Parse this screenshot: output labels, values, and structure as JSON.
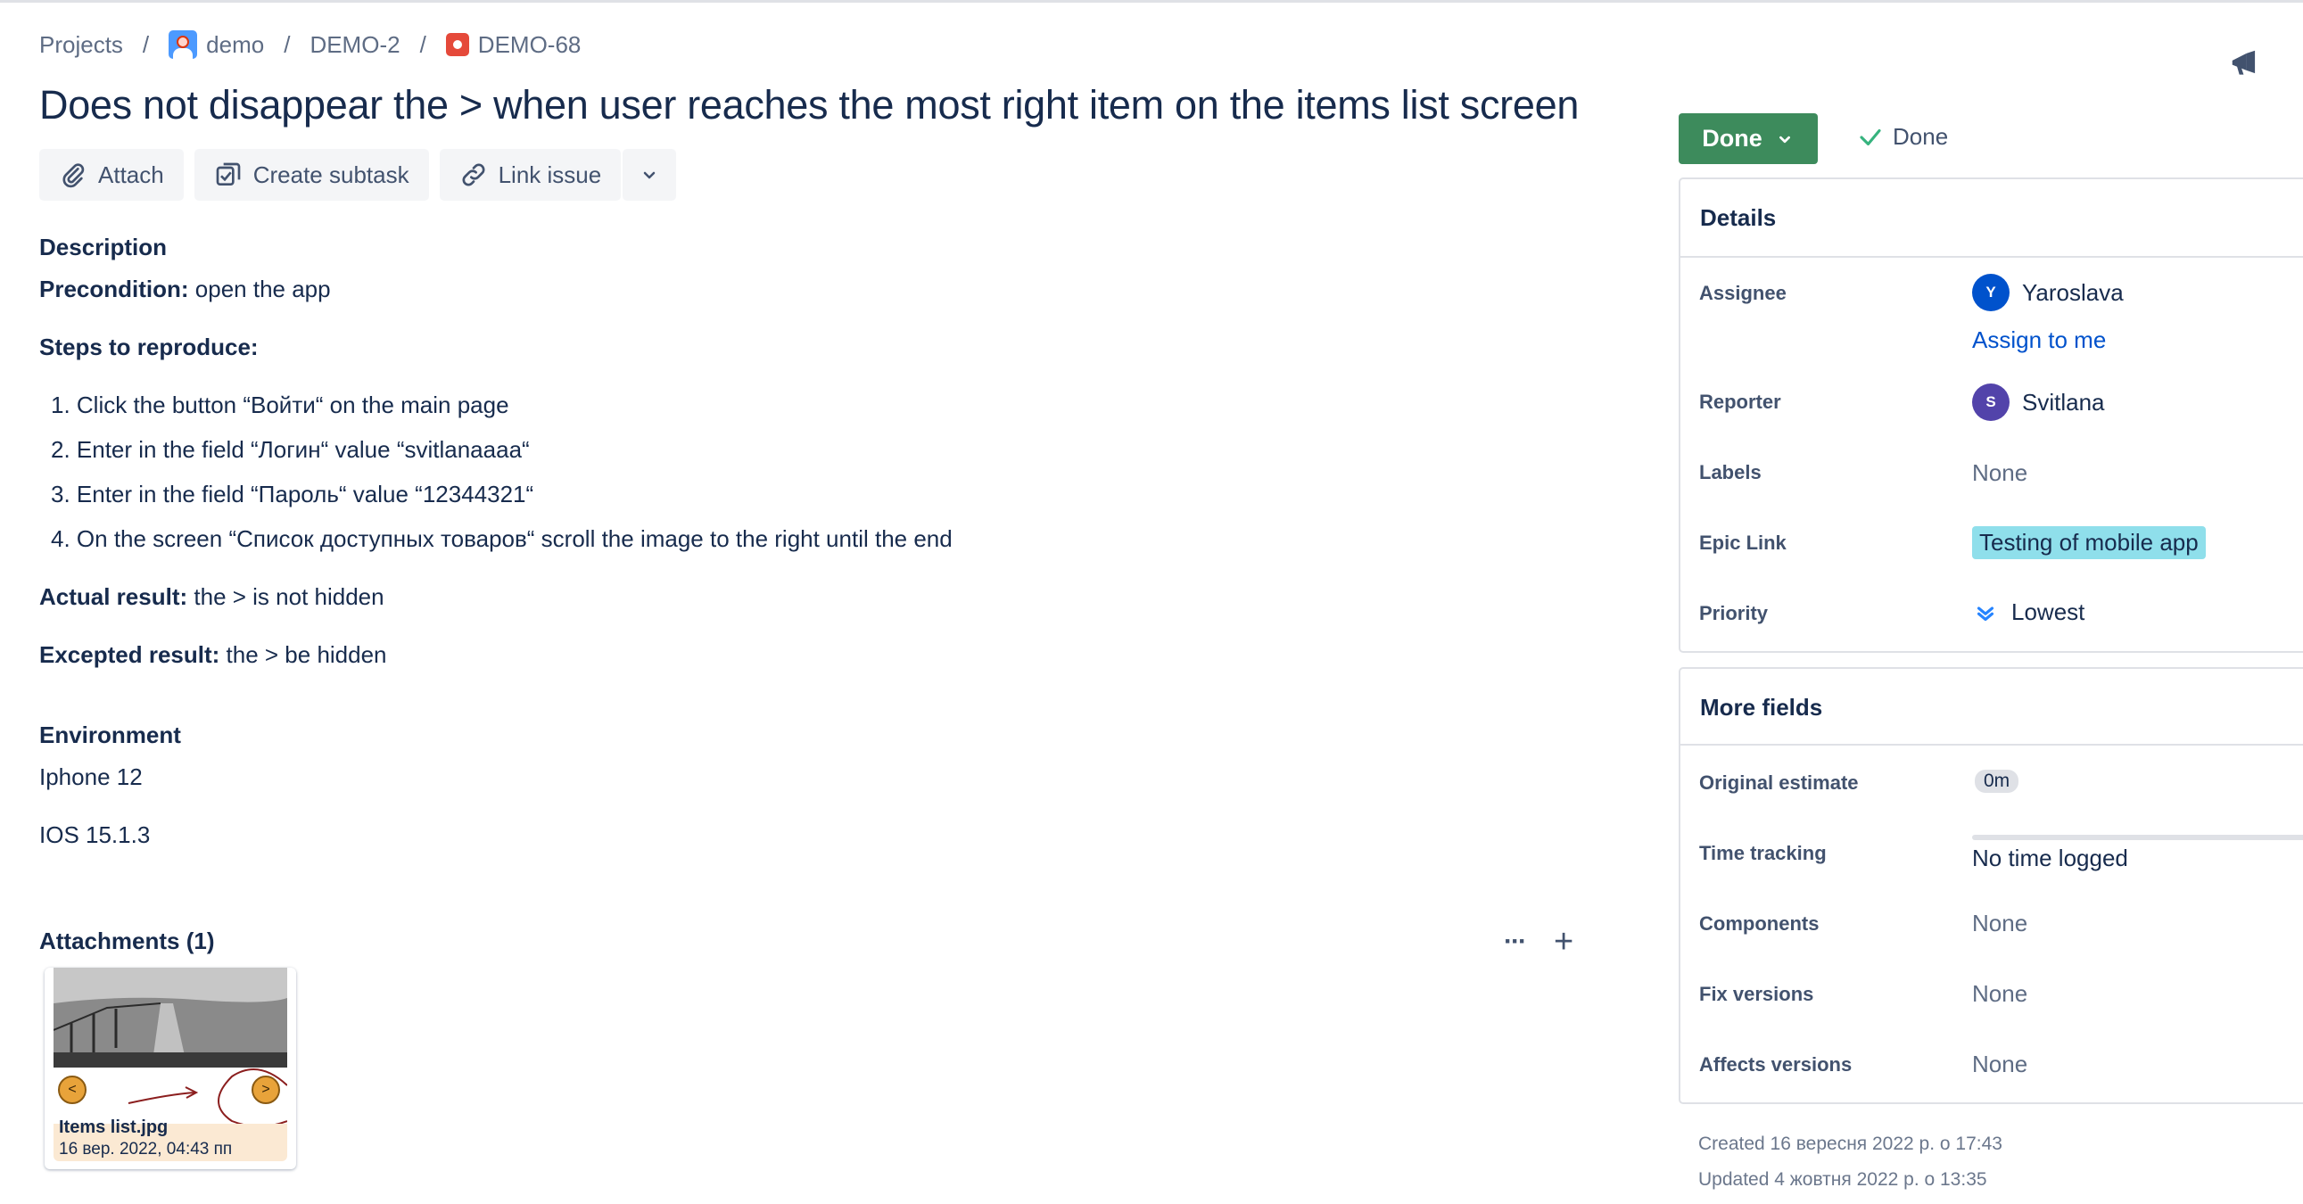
{
  "breadcrumb": {
    "projects": "Projects",
    "project": "demo",
    "epic": "DEMO-2",
    "issue": "DEMO-68",
    "separator": "/"
  },
  "icons": {
    "project_avatar": "project-avatar-icon",
    "issue_type": "bug-icon",
    "announce": "megaphone-icon",
    "attach": "paperclip-icon",
    "subtask": "subtask-icon",
    "link": "link-icon",
    "more": "chevron-down-icon",
    "priority": "priority-lowest-icon"
  },
  "issue": {
    "title": "Does not disappear the > when user reaches the most right item on the items list screen"
  },
  "toolbar": {
    "attach": "Attach",
    "create_subtask": "Create subtask",
    "link_issue": "Link issue"
  },
  "description": {
    "heading": "Description",
    "precondition_label": "Precondition:",
    "precondition_text": " open the app",
    "steps_heading": "Steps to reproduce:",
    "steps": [
      "1.  Click the button “Войти“ on the main page",
      "2.  Enter in the field “Логин“ value “svitlanaaaa“",
      "3.  Enter in the field “Пароль“ value “12344321“",
      "4.  On the screen “Список доступных товаров“ scroll the image to the right until the end"
    ],
    "actual_label": "Actual result:",
    "actual_text": " the > is not hidden",
    "expected_label": "Excepted result:",
    "expected_text": " the > be hidden"
  },
  "environment": {
    "heading": "Environment",
    "lines": [
      "Iphone 12",
      "IOS 15.1.3"
    ]
  },
  "attachments": {
    "heading": "Attachments (1)",
    "more": "···",
    "add": "+",
    "items": [
      {
        "name": "Items list.jpg",
        "date": "16 вер. 2022, 04:43 пп",
        "prev": "<",
        "next": ">"
      }
    ]
  },
  "status": {
    "button": "Done",
    "resolution": "Done",
    "colors": {
      "button_bg": "#3d8b5c",
      "check": "#36b37e"
    }
  },
  "details": {
    "heading": "Details",
    "assignee_label": "Assignee",
    "assignee_name": "Yaroslava",
    "assignee_initial": "Y",
    "assign_to_me": "Assign to me",
    "reporter_label": "Reporter",
    "reporter_name": "Svitlana",
    "reporter_initial": "S",
    "labels_label": "Labels",
    "labels_value": "None",
    "epic_label": "Epic Link",
    "epic_value": "Testing of mobile app",
    "priority_label": "Priority",
    "priority_value": "Lowest",
    "colors": {
      "assignee_avatar": "#0052cc",
      "reporter_avatar": "#5243aa",
      "epic_bg": "#8fdfeb",
      "link": "#0052cc"
    }
  },
  "more_fields": {
    "heading": "More fields",
    "original_estimate_label": "Original estimate",
    "original_estimate_value": "0m",
    "time_tracking_label": "Time tracking",
    "time_tracking_value": "No time logged",
    "components_label": "Components",
    "components_value": "None",
    "fix_versions_label": "Fix versions",
    "fix_versions_value": "None",
    "affects_versions_label": "Affects versions",
    "affects_versions_value": "None"
  },
  "meta": {
    "created": "Created 16 вересня 2022 р. о 17:43",
    "updated": "Updated 4 жовтня 2022 р. о 13:35"
  }
}
